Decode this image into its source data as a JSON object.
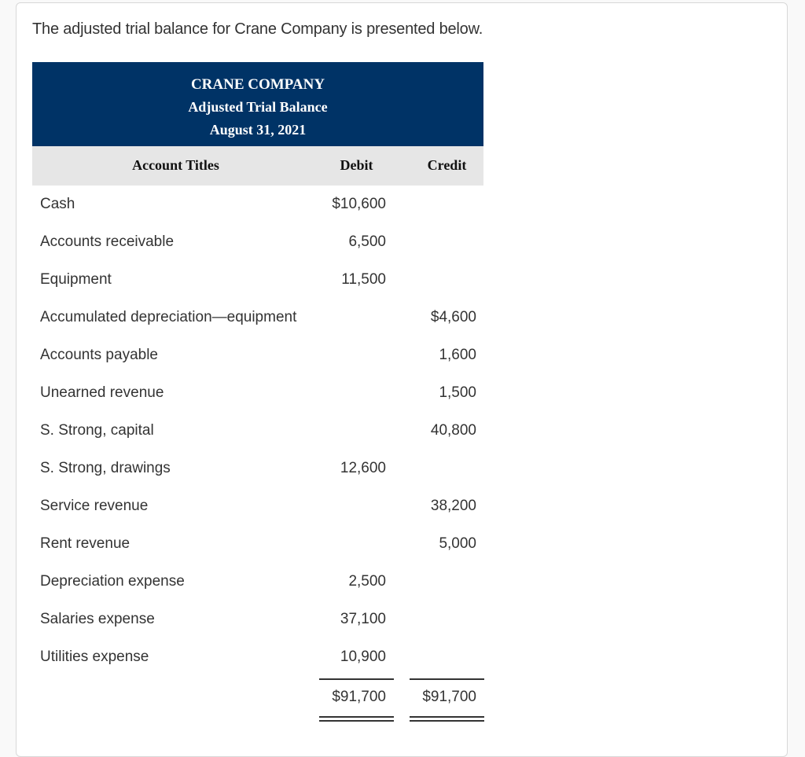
{
  "intro_text": "The adjusted trial balance for Crane Company is presented below.",
  "statement": {
    "company": "CRANE COMPANY",
    "title": "Adjusted Trial Balance",
    "date": "August 31, 2021",
    "header_bg_color": "#003366"
  },
  "columns": {
    "account": "Account Titles",
    "debit": "Debit",
    "credit": "Credit"
  },
  "rows": [
    {
      "account": "Cash",
      "debit": "$10,600",
      "credit": ""
    },
    {
      "account": "Accounts receivable",
      "debit": "6,500",
      "credit": ""
    },
    {
      "account": "Equipment",
      "debit": "11,500",
      "credit": ""
    },
    {
      "account": "Accumulated depreciation—equipment",
      "debit": "",
      "credit": "$4,600"
    },
    {
      "account": "Accounts payable",
      "debit": "",
      "credit": "1,600"
    },
    {
      "account": "Unearned revenue",
      "debit": "",
      "credit": "1,500"
    },
    {
      "account": "S. Strong, capital",
      "debit": "",
      "credit": "40,800"
    },
    {
      "account": "S. Strong, drawings",
      "debit": "12,600",
      "credit": ""
    },
    {
      "account": "Service revenue",
      "debit": "",
      "credit": "38,200"
    },
    {
      "account": "Rent revenue",
      "debit": "",
      "credit": "5,000"
    },
    {
      "account": "Depreciation expense",
      "debit": "2,500",
      "credit": ""
    },
    {
      "account": "Salaries expense",
      "debit": "37,100",
      "credit": ""
    },
    {
      "account": "Utilities expense",
      "debit": "10,900",
      "credit": ""
    }
  ],
  "totals": {
    "debit": "$91,700",
    "credit": "$91,700"
  }
}
